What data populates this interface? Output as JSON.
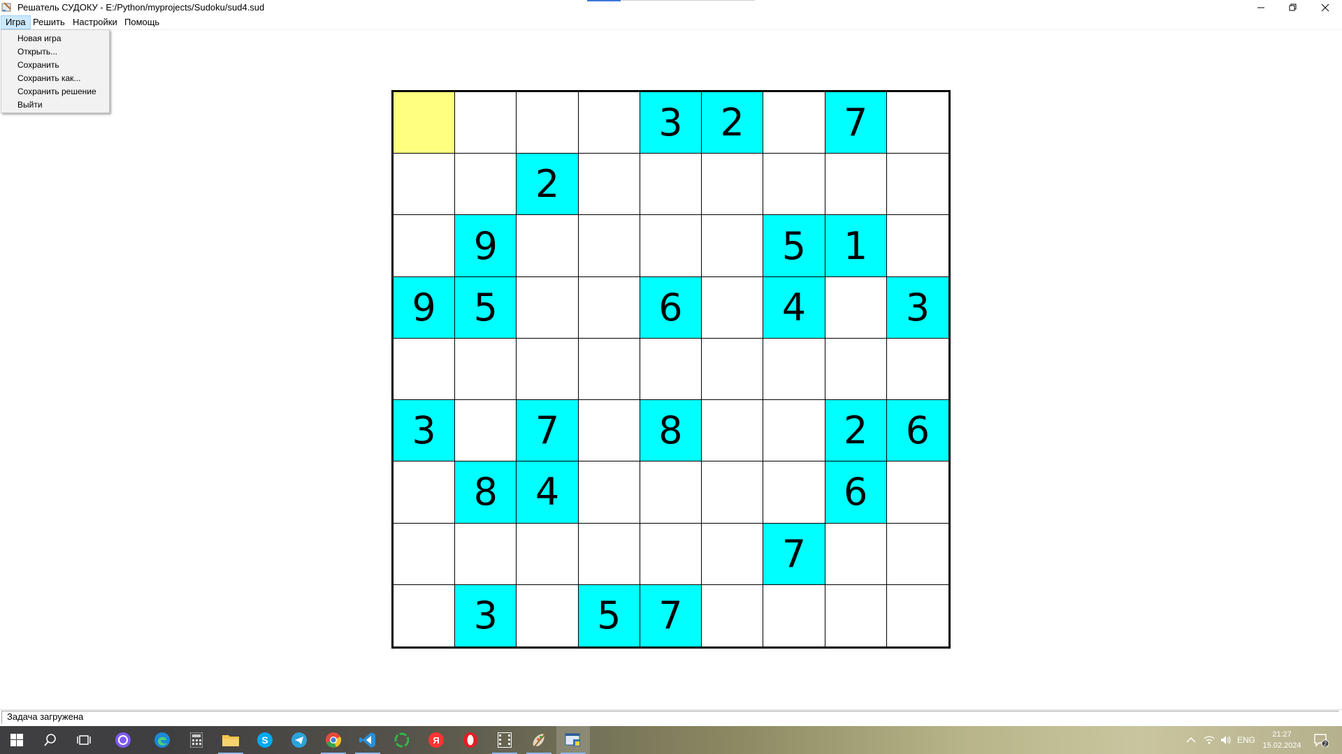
{
  "window": {
    "title": "Решатель СУДОКУ - E:/Python/myprojects/Sudoku/sud4.sud"
  },
  "menu": {
    "items": [
      "Игра",
      "Решить",
      "Настройки",
      "Помощь"
    ],
    "active_index": 0
  },
  "dropdown": {
    "items": [
      "Новая игра",
      "Открыть...",
      "Сохранить",
      "Сохранить как...",
      "Сохранить решение",
      "Выйти"
    ]
  },
  "board": {
    "size": 9,
    "selected": [
      0,
      0
    ],
    "colors": {
      "given": "#00ffff",
      "selected": "#ffff80",
      "empty": "#ffffff",
      "grid": "#000000"
    },
    "grid": [
      [
        0,
        0,
        0,
        0,
        3,
        2,
        0,
        7,
        0
      ],
      [
        0,
        0,
        2,
        0,
        0,
        0,
        0,
        0,
        0
      ],
      [
        0,
        9,
        0,
        0,
        0,
        0,
        5,
        1,
        0
      ],
      [
        9,
        5,
        0,
        0,
        6,
        0,
        4,
        0,
        3
      ],
      [
        0,
        0,
        0,
        0,
        0,
        0,
        0,
        0,
        0
      ],
      [
        3,
        0,
        7,
        0,
        8,
        0,
        0,
        2,
        6
      ],
      [
        0,
        8,
        4,
        0,
        0,
        0,
        0,
        6,
        0
      ],
      [
        0,
        0,
        0,
        0,
        0,
        0,
        7,
        0,
        0
      ],
      [
        0,
        3,
        0,
        5,
        7,
        0,
        0,
        0,
        0
      ]
    ]
  },
  "status": {
    "text": "Задача загружена"
  },
  "taskbar": {
    "apps": [
      "windows-start-icon",
      "search-icon",
      "task-view-icon",
      "alice-icon",
      "edge-icon",
      "calculator-icon",
      "file-explorer-icon",
      "skype-icon",
      "telegram-icon",
      "chrome-icon",
      "vscode-icon",
      "refresh-app-icon",
      "yandex-icon",
      "opera-icon",
      "video-icon",
      "paint-icon",
      "python-app-icon"
    ],
    "tray_language": "ENG",
    "time": "21:27",
    "date": "15.02.2024",
    "notifications": "2"
  }
}
